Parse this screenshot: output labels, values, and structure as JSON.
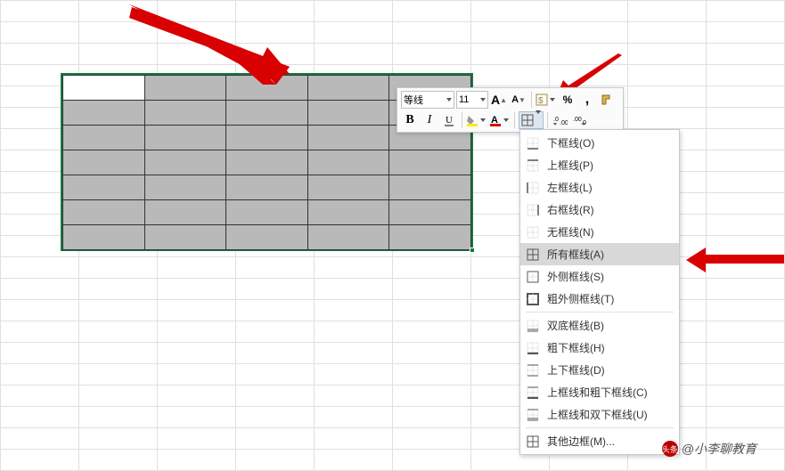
{
  "toolbar": {
    "font_name": "等线",
    "font_size": "11",
    "increase_font_tip": "A",
    "decrease_font_tip": "A",
    "percent": "%",
    "comma": ",",
    "bold": "B",
    "italic": "I"
  },
  "border_menu": {
    "items": [
      {
        "label": "下框线(O)",
        "type": "bottom"
      },
      {
        "label": "上框线(P)",
        "type": "top"
      },
      {
        "label": "左框线(L)",
        "type": "left"
      },
      {
        "label": "右框线(R)",
        "type": "right"
      },
      {
        "label": "无框线(N)",
        "type": "none"
      },
      {
        "label": "所有框线(A)",
        "type": "all",
        "highlight": true
      },
      {
        "label": "外侧框线(S)",
        "type": "outside"
      },
      {
        "label": "粗外侧框线(T)",
        "type": "thick_outside"
      },
      {
        "sep": true
      },
      {
        "label": "双底框线(B)",
        "type": "double_bottom"
      },
      {
        "label": "粗下框线(H)",
        "type": "thick_bottom"
      },
      {
        "label": "上下框线(D)",
        "type": "top_bottom"
      },
      {
        "label": "上框线和粗下框线(C)",
        "type": "top_thick_bottom"
      },
      {
        "label": "上框线和双下框线(U)",
        "type": "top_double_bottom"
      },
      {
        "sep": true
      },
      {
        "label": "其他边框(M)...",
        "type": "more"
      }
    ]
  },
  "watermark": {
    "brand": "头条",
    "handle": "@小李聊教育"
  },
  "selection": {
    "rows": 7,
    "cols": 5
  }
}
